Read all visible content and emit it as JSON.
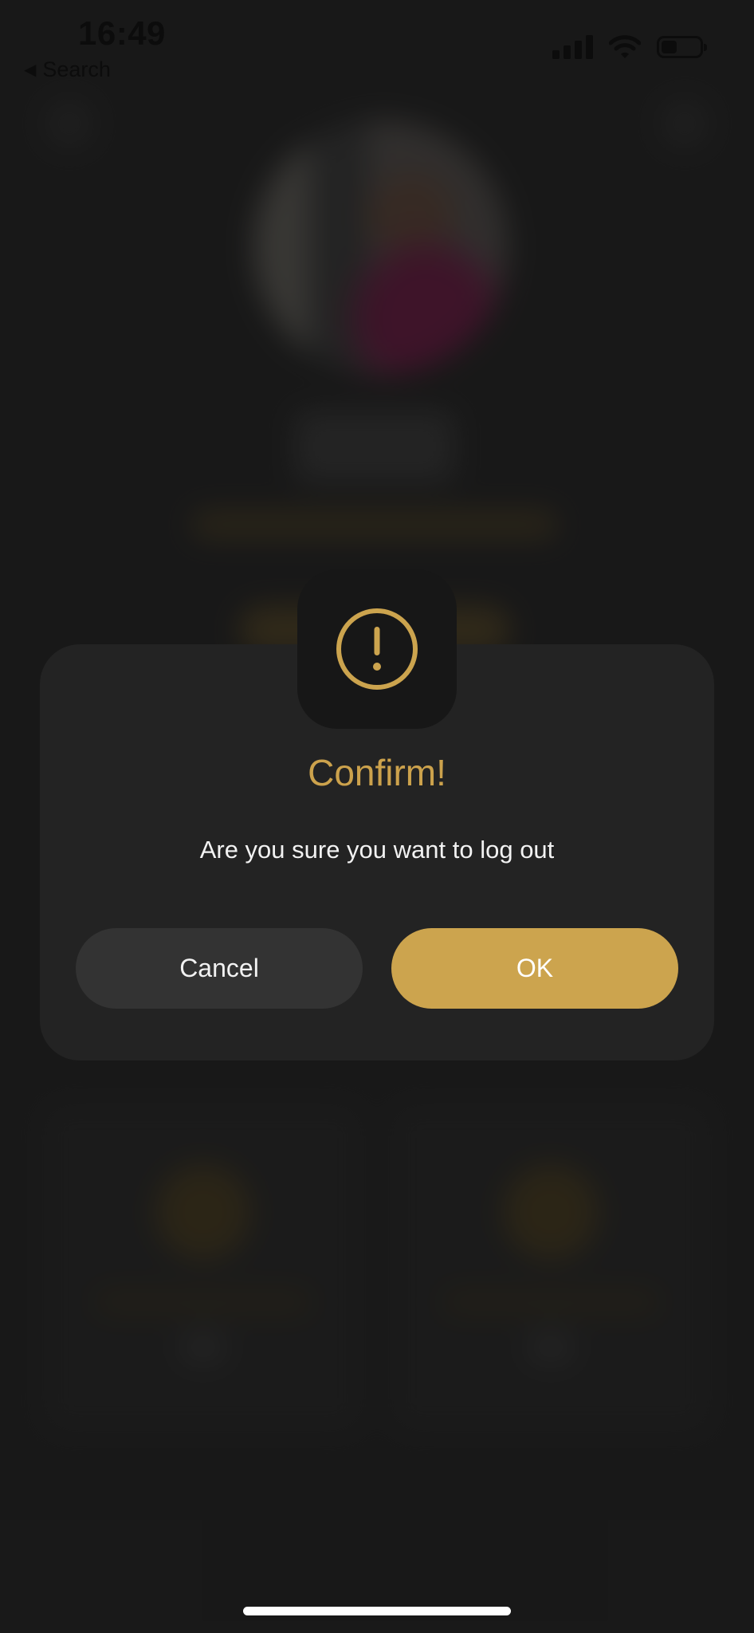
{
  "status_bar": {
    "time": "16:49",
    "back_label": "Search",
    "battery_level": 0.42
  },
  "dialog": {
    "icon": "exclamation-circle-icon",
    "title": "Confirm!",
    "message": "Are you sure you want to log out",
    "cancel_label": "Cancel",
    "ok_label": "OK"
  },
  "colors": {
    "accent": "#cca44e",
    "background": "#1e1e1e",
    "dialog_background": "#232323",
    "cancel_button": "#333333"
  }
}
